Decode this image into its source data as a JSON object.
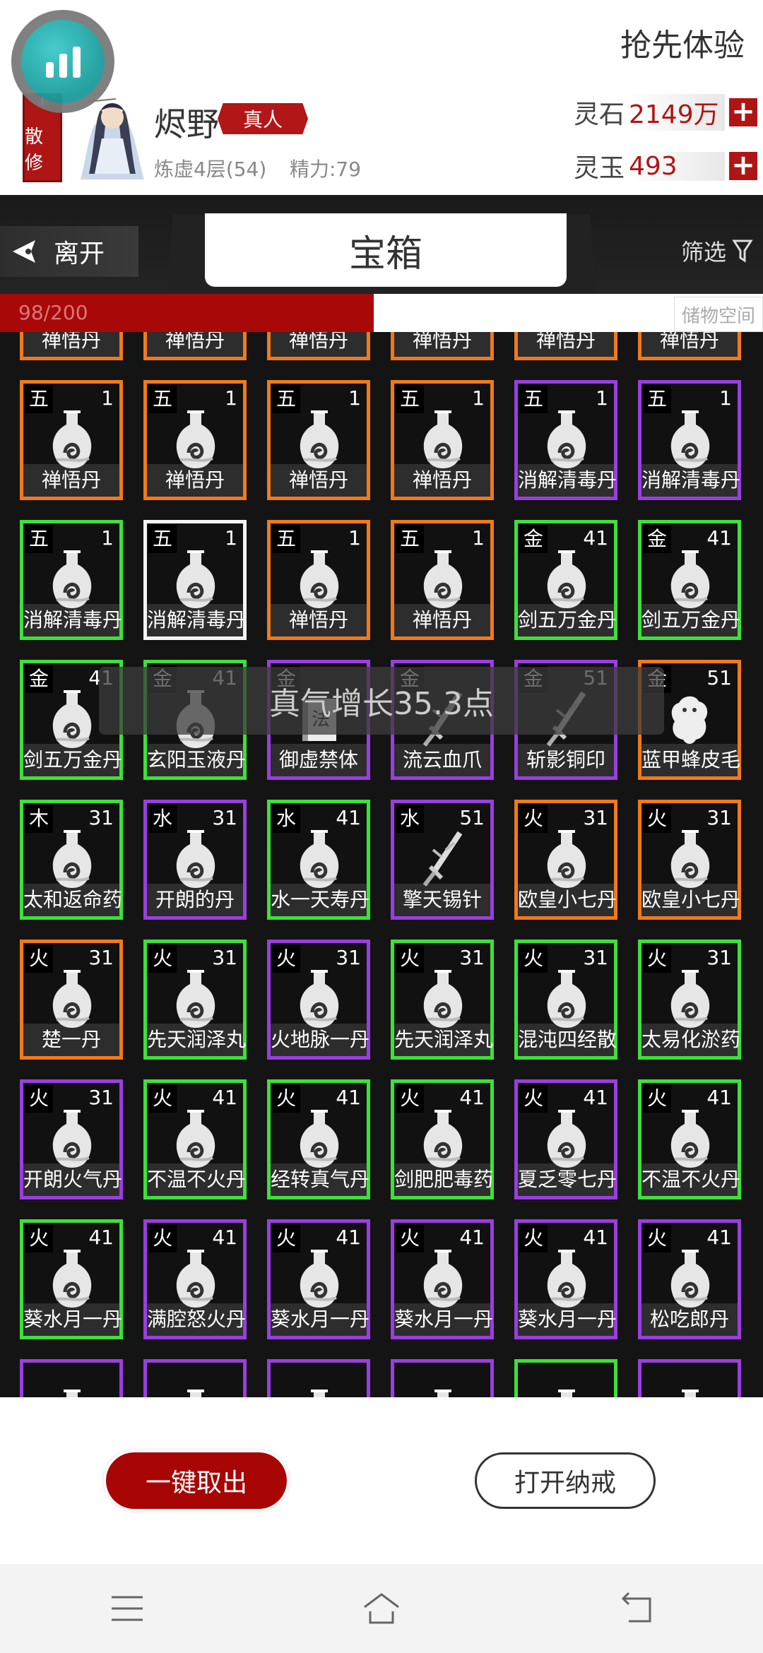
{
  "header": {
    "trial_label": "抢先体验",
    "sect_label": "散修",
    "player_name": "烬野",
    "title_tag": "真人",
    "realm": "炼虚4层(54)",
    "energy": "精力:79",
    "currencies": [
      {
        "label": "灵石",
        "value": "2149万"
      },
      {
        "label": "灵玉",
        "value": "493"
      }
    ]
  },
  "tabs": {
    "leave_label": "离开",
    "title": "宝箱",
    "filter_label": "筛选"
  },
  "capacity": {
    "text": "98/200",
    "fraction": 0.49,
    "storage_label": "储物空间"
  },
  "toast": "真气增长35.3点",
  "grid": [
    [
      {
        "el": "",
        "lv": "",
        "name": "禅悟丹",
        "color": "orange",
        "icon": "pill-bottle-icon"
      },
      {
        "el": "",
        "lv": "",
        "name": "禅悟丹",
        "color": "orange",
        "icon": "pill-bottle-icon"
      },
      {
        "el": "",
        "lv": "",
        "name": "禅悟丹",
        "color": "orange",
        "icon": "pill-bottle-icon"
      },
      {
        "el": "",
        "lv": "",
        "name": "禅悟丹",
        "color": "orange",
        "icon": "pill-bottle-icon"
      },
      {
        "el": "",
        "lv": "",
        "name": "禅悟丹",
        "color": "orange",
        "icon": "pill-bottle-icon"
      },
      {
        "el": "",
        "lv": "",
        "name": "禅悟丹",
        "color": "orange",
        "icon": "pill-bottle-icon"
      }
    ],
    [
      {
        "el": "五",
        "lv": "1",
        "name": "禅悟丹",
        "color": "orange",
        "icon": "pill-bottle-icon"
      },
      {
        "el": "五",
        "lv": "1",
        "name": "禅悟丹",
        "color": "orange",
        "icon": "pill-bottle-icon"
      },
      {
        "el": "五",
        "lv": "1",
        "name": "禅悟丹",
        "color": "orange",
        "icon": "pill-bottle-icon"
      },
      {
        "el": "五",
        "lv": "1",
        "name": "禅悟丹",
        "color": "orange",
        "icon": "pill-bottle-icon"
      },
      {
        "el": "五",
        "lv": "1",
        "name": "消解清毒丹",
        "color": "purple",
        "icon": "pill-bottle-icon"
      },
      {
        "el": "五",
        "lv": "1",
        "name": "消解清毒丹",
        "color": "purple",
        "icon": "pill-bottle-icon"
      }
    ],
    [
      {
        "el": "五",
        "lv": "1",
        "name": "消解清毒丹",
        "color": "green",
        "icon": "pill-bottle-icon"
      },
      {
        "el": "五",
        "lv": "1",
        "name": "消解清毒丹",
        "color": "white",
        "icon": "pill-bottle-icon"
      },
      {
        "el": "五",
        "lv": "1",
        "name": "禅悟丹",
        "color": "orange",
        "icon": "pill-bottle-icon"
      },
      {
        "el": "五",
        "lv": "1",
        "name": "禅悟丹",
        "color": "orange",
        "icon": "pill-bottle-icon"
      },
      {
        "el": "金",
        "lv": "41",
        "name": "剑五万金丹",
        "color": "green",
        "icon": "pill-bottle-icon"
      },
      {
        "el": "金",
        "lv": "41",
        "name": "剑五万金丹",
        "color": "green",
        "icon": "pill-bottle-icon"
      }
    ],
    [
      {
        "el": "金",
        "lv": "41",
        "name": "剑五万金丹",
        "color": "green",
        "icon": "pill-bottle-icon"
      },
      {
        "el": "金",
        "lv": "41",
        "name": "玄阳玉液丹",
        "color": "green",
        "icon": "pill-bottle-icon"
      },
      {
        "el": "金",
        "lv": "",
        "name": "御虚禁体",
        "color": "purple",
        "icon": "manual-book-icon"
      },
      {
        "el": "金",
        "lv": "",
        "name": "流云血爪",
        "color": "purple",
        "icon": "weapon-icon"
      },
      {
        "el": "金",
        "lv": "51",
        "name": "斩影铜印",
        "color": "purple",
        "icon": "weapon-icon"
      },
      {
        "el": "金",
        "lv": "51",
        "name": "蓝甲蜂皮毛",
        "color": "orange",
        "icon": "pelt-icon"
      }
    ],
    [
      {
        "el": "木",
        "lv": "31",
        "name": "太和返命药",
        "color": "green",
        "icon": "pill-bottle-icon"
      },
      {
        "el": "水",
        "lv": "31",
        "name": "开朗的丹",
        "color": "purple",
        "icon": "pill-bottle-icon"
      },
      {
        "el": "水",
        "lv": "41",
        "name": "水一天寿丹",
        "color": "green",
        "icon": "pill-bottle-icon"
      },
      {
        "el": "水",
        "lv": "51",
        "name": "擎天锡针",
        "color": "purple",
        "icon": "weapon-icon"
      },
      {
        "el": "火",
        "lv": "31",
        "name": "欧皇小七丹",
        "color": "orange",
        "icon": "pill-bottle-icon"
      },
      {
        "el": "火",
        "lv": "31",
        "name": "欧皇小七丹",
        "color": "orange",
        "icon": "pill-bottle-icon"
      }
    ],
    [
      {
        "el": "火",
        "lv": "31",
        "name": "楚一丹",
        "color": "orange",
        "icon": "pill-bottle-icon"
      },
      {
        "el": "火",
        "lv": "31",
        "name": "先天润泽丸",
        "color": "green",
        "icon": "pill-bottle-icon"
      },
      {
        "el": "火",
        "lv": "31",
        "name": "火地脉一丹",
        "color": "purple",
        "icon": "pill-bottle-icon"
      },
      {
        "el": "火",
        "lv": "31",
        "name": "先天润泽丸",
        "color": "green",
        "icon": "pill-bottle-icon"
      },
      {
        "el": "火",
        "lv": "31",
        "name": "混沌四经散",
        "color": "green",
        "icon": "pill-bottle-icon"
      },
      {
        "el": "火",
        "lv": "31",
        "name": "太易化淤药",
        "color": "green",
        "icon": "pill-bottle-icon"
      }
    ],
    [
      {
        "el": "火",
        "lv": "31",
        "name": "开朗火气丹",
        "color": "purple",
        "icon": "pill-bottle-icon"
      },
      {
        "el": "火",
        "lv": "41",
        "name": "不温不火丹",
        "color": "green",
        "icon": "pill-bottle-icon"
      },
      {
        "el": "火",
        "lv": "41",
        "name": "经转真气丹",
        "color": "green",
        "icon": "pill-bottle-icon"
      },
      {
        "el": "火",
        "lv": "41",
        "name": "剑肥肥毒药",
        "color": "green",
        "icon": "pill-bottle-icon"
      },
      {
        "el": "火",
        "lv": "41",
        "name": "夏乏零七丹",
        "color": "purple",
        "icon": "pill-bottle-icon"
      },
      {
        "el": "火",
        "lv": "41",
        "name": "不温不火丹",
        "color": "green",
        "icon": "pill-bottle-icon"
      }
    ],
    [
      {
        "el": "火",
        "lv": "41",
        "name": "葵水月一丹",
        "color": "green",
        "icon": "pill-bottle-icon"
      },
      {
        "el": "火",
        "lv": "41",
        "name": "满腔怒火丹",
        "color": "purple",
        "icon": "pill-bottle-icon"
      },
      {
        "el": "火",
        "lv": "41",
        "name": "葵水月一丹",
        "color": "purple",
        "icon": "pill-bottle-icon"
      },
      {
        "el": "火",
        "lv": "41",
        "name": "葵水月一丹",
        "color": "purple",
        "icon": "pill-bottle-icon"
      },
      {
        "el": "火",
        "lv": "41",
        "name": "葵水月一丹",
        "color": "purple",
        "icon": "pill-bottle-icon"
      },
      {
        "el": "火",
        "lv": "41",
        "name": "松吃郎丹",
        "color": "purple",
        "icon": "pill-bottle-icon"
      }
    ],
    [
      {
        "el": "",
        "lv": "",
        "name": "",
        "color": "purple",
        "icon": "pill-bottle-icon"
      },
      {
        "el": "",
        "lv": "",
        "name": "",
        "color": "purple",
        "icon": "pill-bottle-icon"
      },
      {
        "el": "",
        "lv": "",
        "name": "",
        "color": "purple",
        "icon": "pill-bottle-icon"
      },
      {
        "el": "",
        "lv": "",
        "name": "",
        "color": "purple",
        "icon": "pill-bottle-icon"
      },
      {
        "el": "",
        "lv": "",
        "name": "",
        "color": "green",
        "icon": "pill-bottle-icon"
      },
      {
        "el": "",
        "lv": "",
        "name": "",
        "color": "purple",
        "icon": "pill-bottle-icon"
      }
    ]
  ],
  "actions": {
    "take_all": "一键取出",
    "open_ring": "打开纳戒"
  },
  "navbar": [
    "menu-icon",
    "home-icon",
    "back-icon"
  ]
}
